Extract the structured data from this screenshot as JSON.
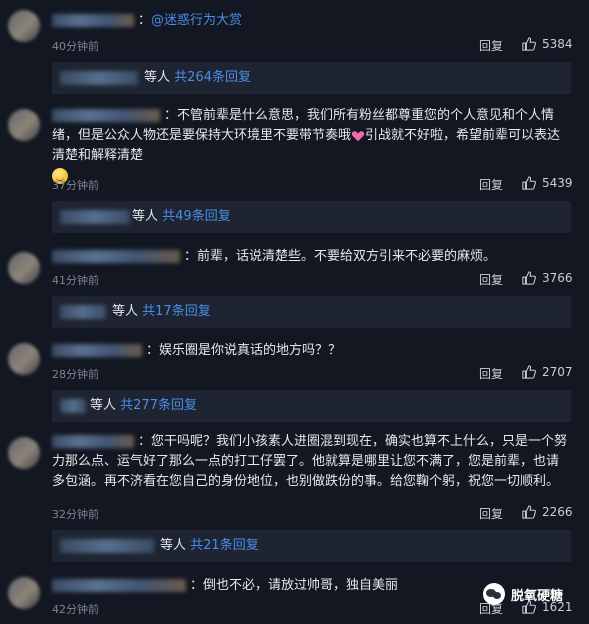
{
  "reply_label": "回复",
  "etal_label": "等人",
  "comments": [
    {
      "mention": "@迷惑行为大赏",
      "text": "",
      "time": "40分钟前",
      "likes": "5384",
      "replies": "共264条回复"
    },
    {
      "text": "不管前辈是什么意思，我们所有粉丝都尊重您的个人意见和个人情绪，但是公众人物还是要保持大环境里不要带节奏哦",
      "text2": "引战就不好啦，希望前辈可以表达清楚和解释清楚",
      "time": "37分钟前",
      "likes": "5439",
      "replies": "共49条回复"
    },
    {
      "text": "前辈，话说清楚些。不要给双方引来不必要的麻烦。",
      "time": "41分钟前",
      "likes": "3766",
      "replies": "共17条回复"
    },
    {
      "text": "娱乐圈是你说真话的地方吗？？",
      "time": "28分钟前",
      "likes": "2707",
      "replies": "共277条回复"
    },
    {
      "text": "您干吗呢？我们小孩素人进圈混到现在，确实也算不上什么，只是一个努力那么点、运气好了那么一点的打工仔罢了。他就算是哪里让您不满了，您是前辈，也请多包涵。再不济看在您自己的身份地位，也别做跌份的事。给您鞠个躬，祝您一切顺利。",
      "time": "32分钟前",
      "likes": "2266",
      "replies": "共21条回复"
    },
    {
      "text": "倒也不必，请放过帅哥，独自美丽",
      "time": "42分钟前",
      "likes": "1621"
    }
  ],
  "watermark": "脱氧硬糖",
  "icons": {
    "like": "thumbs-up-icon",
    "emoji": "smile-emoji-icon",
    "heart": "sparkle-heart-icon"
  }
}
